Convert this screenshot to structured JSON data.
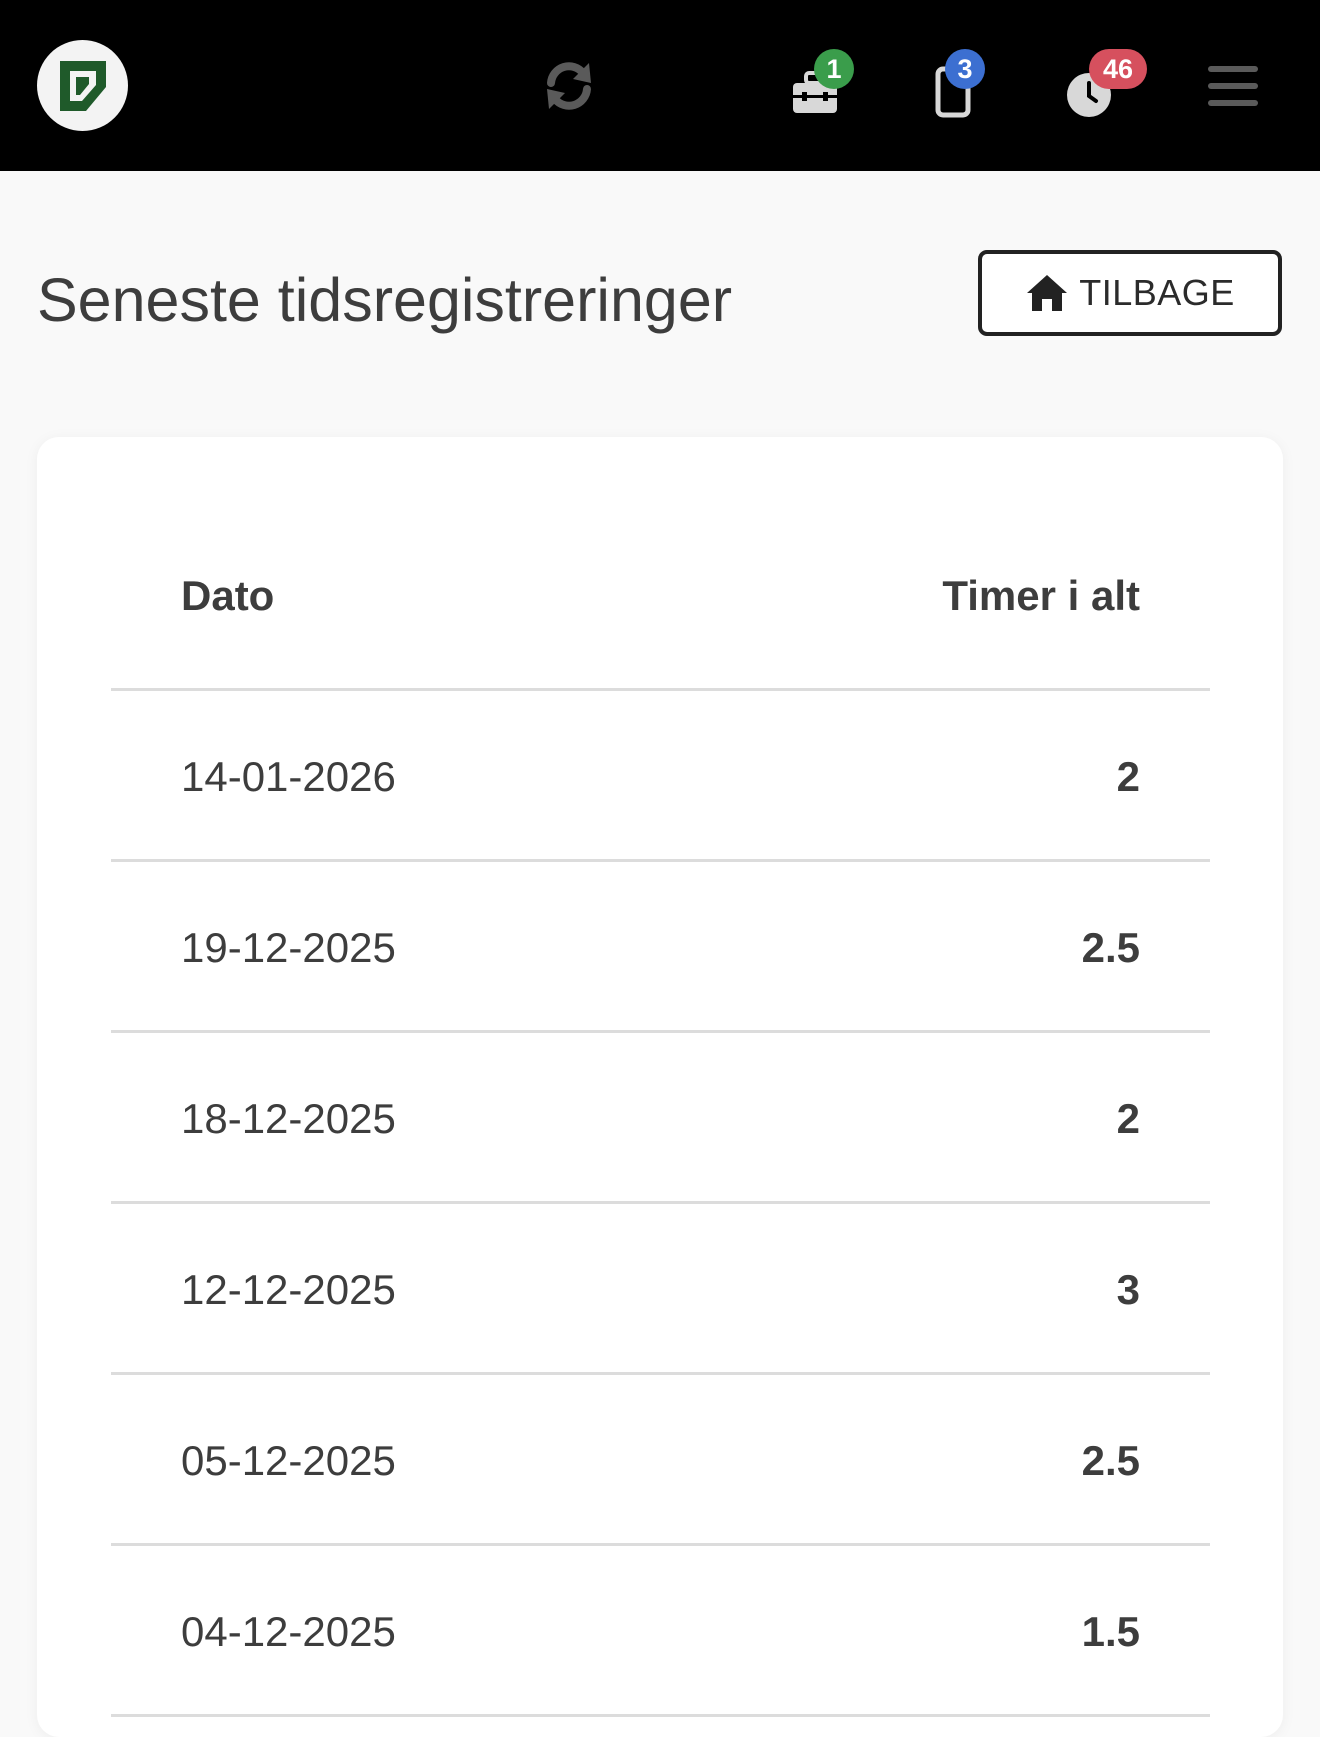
{
  "topbar": {
    "logo_name": "app-logo",
    "sync_icon": "refresh-icon",
    "toolbox": {
      "icon": "toolbox-icon",
      "badge": "1",
      "badge_color": "#3a9d4b"
    },
    "tablet": {
      "icon": "tablet-icon",
      "badge": "3",
      "badge_color": "#3c6fd1"
    },
    "clock": {
      "icon": "clock-icon",
      "badge": "46",
      "badge_color": "#d6505e"
    },
    "menu_icon": "hamburger-menu-icon"
  },
  "page": {
    "title": "Seneste tidsregistreringer",
    "back_button_label": "TILBAGE",
    "back_button_icon": "home-icon"
  },
  "table": {
    "headers": {
      "date": "Dato",
      "hours": "Timer i alt"
    },
    "rows": [
      {
        "date": "14-01-2026",
        "hours": "2"
      },
      {
        "date": "19-12-2025",
        "hours": "2.5"
      },
      {
        "date": "18-12-2025",
        "hours": "2"
      },
      {
        "date": "12-12-2025",
        "hours": "3"
      },
      {
        "date": "05-12-2025",
        "hours": "2.5"
      },
      {
        "date": "04-12-2025",
        "hours": "1.5"
      }
    ]
  },
  "colors": {
    "topbar_bg": "#000000",
    "logo_green": "#1f5a2a",
    "page_bg": "#f9f9f9",
    "text": "#3d3d3d"
  }
}
